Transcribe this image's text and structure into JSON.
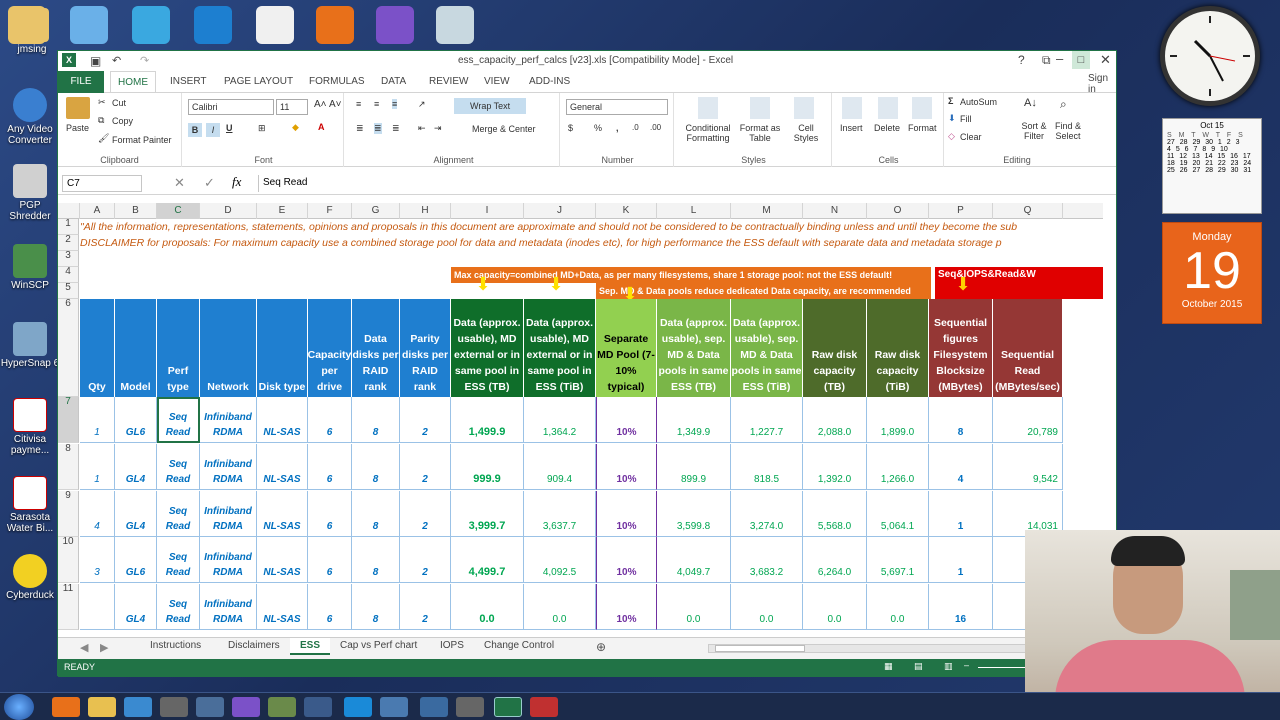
{
  "desktop": {
    "icons": [
      "jmsing",
      "Any Video Converter",
      "PGP Shredder",
      "WinSCP",
      "HyperSnap 6",
      "Citivisa payme...",
      "Sarasota Water Bi...",
      "Cyberduck"
    ]
  },
  "calendar": {
    "month": "Oct 15",
    "day_name": "Monday",
    "day": "19",
    "month_year": "October 2015",
    "week_header": "S M T W T F S",
    "rows": [
      "27 28 29 30 1 2 3",
      "4 5 6 7 8 9 10",
      "11 12 13 14 15 16 17",
      "18 19 20 21 22 23 24",
      "25 26 27 28 29 30 31"
    ]
  },
  "excel": {
    "title": "ess_capacity_perf_calcs [v23].xls  [Compatibility Mode] - Excel",
    "tabs": [
      "FILE",
      "HOME",
      "INSERT",
      "PAGE LAYOUT",
      "FORMULAS",
      "DATA",
      "REVIEW",
      "VIEW",
      "ADD-INS"
    ],
    "signin": "Sign in",
    "ribbon": {
      "clipboard": {
        "paste": "Paste",
        "cut": "Cut",
        "copy": "Copy",
        "painter": "Format Painter",
        "name": "Clipboard"
      },
      "font": {
        "family": "Calibri",
        "size": "11",
        "name": "Font"
      },
      "alignment": {
        "wrap": "Wrap Text",
        "merge": "Merge & Center",
        "name": "Alignment"
      },
      "number": {
        "format": "General",
        "name": "Number"
      },
      "styles": {
        "cond": "Conditional Formatting",
        "table": "Format as Table",
        "cell": "Cell Styles",
        "name": "Styles"
      },
      "cells": {
        "insert": "Insert",
        "delete": "Delete",
        "format": "Format",
        "name": "Cells"
      },
      "editing": {
        "autosum": "AutoSum",
        "fill": "Fill",
        "clear": "Clear",
        "sort": "Sort & Filter",
        "find": "Find & Select",
        "name": "Editing"
      }
    },
    "namebox": "C7",
    "formula": "Seq Read",
    "columns": [
      "A",
      "B",
      "C",
      "D",
      "E",
      "F",
      "G",
      "H",
      "I",
      "J",
      "K",
      "L",
      "M",
      "N",
      "O",
      "P",
      "Q"
    ],
    "disclaimer1": "\"All the information, representations, statements, opinions and proposals in this document are approximate and should not be considered to be contractually binding unless and until they become the sub",
    "disclaimer2": "DISCLAIMER for proposals: For maximum capacity use a combined storage pool for data and metadata (inodes etc), for high performance the ESS default with separate data and metadata storage p",
    "banner1": "Max capacity=combined MD+Data, as per many filesystems, share 1 storage pool: not the ESS default!",
    "banner2": "Sep. MD & Data pools reduce dedicated Data capacity, are recommended",
    "banner3": "Seq&IOPS&Read&W",
    "headers": [
      "Qty",
      "Model",
      "Perf type",
      "Network",
      "Disk type",
      "Capacity per drive",
      "Data disks per RAID rank",
      "Parity disks per RAID rank",
      "Data (approx. usable), MD external or in same pool in ESS (TB)",
      "Data (approx. usable), MD external or in same pool in ESS (TiB)",
      "Separate MD Pool (7-10% typical)",
      "Data (approx. usable), sep. MD & Data pools in same ESS (TB)",
      "Data (approx. usable), sep. MD & Data pools in same ESS (TiB)",
      "Raw disk capacity (TB)",
      "Raw disk capacity (TiB)",
      "Sequential figures Filesystem Blocksize (MBytes)",
      "Sequential Read (MBytes/sec)"
    ],
    "rows": [
      {
        "num": "7",
        "cells": [
          "1",
          "GL6",
          "Seq Read",
          "Infiniband RDMA",
          "NL-SAS",
          "6",
          "8",
          "2",
          "1,499.9",
          "1,364.2",
          "10%",
          "1,349.9",
          "1,227.7",
          "2,088.0",
          "1,899.0",
          "8",
          "20,789"
        ]
      },
      {
        "num": "8",
        "cells": [
          "1",
          "GL4",
          "Seq Read",
          "Infiniband RDMA",
          "NL-SAS",
          "6",
          "8",
          "2",
          "999.9",
          "909.4",
          "10%",
          "899.9",
          "818.5",
          "1,392.0",
          "1,266.0",
          "4",
          "9,542"
        ]
      },
      {
        "num": "9",
        "cells": [
          "4",
          "GL4",
          "Seq Read",
          "Infiniband RDMA",
          "NL-SAS",
          "6",
          "8",
          "2",
          "3,999.7",
          "3,637.7",
          "10%",
          "3,599.8",
          "3,274.0",
          "5,568.0",
          "5,064.1",
          "1",
          "14,031"
        ]
      },
      {
        "num": "10",
        "cells": [
          "3",
          "GL6",
          "Seq Read",
          "Infiniband RDMA",
          "NL-SAS",
          "6",
          "8",
          "2",
          "4,499.7",
          "4,092.5",
          "10%",
          "4,049.7",
          "3,683.2",
          "6,264.0",
          "5,697.1",
          "1",
          ""
        ]
      },
      {
        "num": "11",
        "cells": [
          "",
          "GL4",
          "Seq Read",
          "Infiniband RDMA",
          "NL-SAS",
          "6",
          "8",
          "2",
          "0.0",
          "0.0",
          "10%",
          "0.0",
          "0.0",
          "0.0",
          "0.0",
          "16",
          ""
        ]
      }
    ],
    "sheets": [
      "Instructions",
      "Disclaimers",
      "ESS",
      "Cap vs Perf chart",
      "IOPS",
      "Change Control"
    ],
    "status": "READY"
  }
}
